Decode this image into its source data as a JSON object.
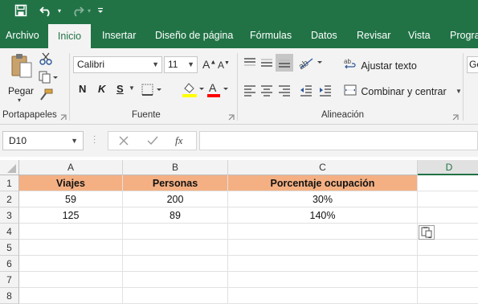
{
  "quick_access": {
    "save_icon": "save-icon",
    "undo_icon": "undo-icon",
    "redo_icon": "redo-icon",
    "customize_icon": "customize-qat-icon"
  },
  "tabs": [
    "Archivo",
    "Inicio",
    "Insertar",
    "Diseño de página",
    "Fórmulas",
    "Datos",
    "Revisar",
    "Vista",
    "Progra"
  ],
  "active_tab": "Inicio",
  "ribbon": {
    "clipboard": {
      "paste_label": "Pegar",
      "group_label": "Portapapeles"
    },
    "font": {
      "font_name": "Calibri",
      "font_size": "11",
      "bold": "N",
      "italic": "K",
      "underline": "S",
      "group_label": "Fuente",
      "fill_color": "#ffff00",
      "font_color": "#ff0000"
    },
    "alignment": {
      "wrap_text": "Ajustar texto",
      "merge_center": "Combinar y centrar",
      "group_label": "Alineación"
    },
    "next_group_partial": "Ge"
  },
  "formula_bar": {
    "name_box": "D10",
    "fx": "fx",
    "formula": ""
  },
  "sheet": {
    "columns": [
      "A",
      "B",
      "C",
      "D"
    ],
    "rows": [
      "1",
      "2",
      "3",
      "4",
      "5",
      "6",
      "7",
      "8"
    ],
    "cells": [
      [
        "Viajes",
        "Personas",
        "Porcentaje ocupación",
        ""
      ],
      [
        "59",
        "200",
        "30%",
        ""
      ],
      [
        "125",
        "89",
        "140%",
        ""
      ],
      [
        "",
        "",
        "",
        ""
      ],
      [
        "",
        "",
        "",
        ""
      ],
      [
        "",
        "",
        "",
        ""
      ],
      [
        "",
        "",
        "",
        ""
      ],
      [
        "",
        "",
        "",
        ""
      ]
    ],
    "header_fill": "#f4b083"
  }
}
